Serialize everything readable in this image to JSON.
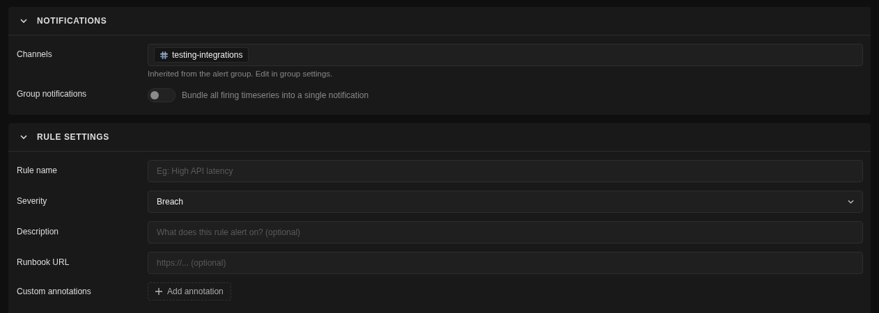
{
  "sections": [
    {
      "title": "NOTIFICATIONS",
      "expanded": true,
      "rows": [
        {
          "kind": "chips",
          "label": "Channels",
          "chips": [
            "testing-integrations"
          ],
          "hint": "Inherited from the alert group. Edit in group settings."
        },
        {
          "kind": "toggle",
          "label": "Group notifications",
          "on": false,
          "description": "Bundle all firing timeseries into a single notification"
        }
      ]
    },
    {
      "title": "RULE SETTINGS",
      "expanded": true,
      "rows": [
        {
          "kind": "text",
          "label": "Rule name",
          "placeholder": "Eg: High API latency"
        },
        {
          "kind": "select",
          "label": "Severity",
          "value": "Breach"
        },
        {
          "kind": "text",
          "label": "Description",
          "placeholder": "What does this rule alert on? (optional)"
        },
        {
          "kind": "text",
          "label": "Runbook URL",
          "placeholder": "https://... (optional)"
        },
        {
          "kind": "add",
          "label": "Custom annotations",
          "button": "Add annotation"
        }
      ]
    }
  ]
}
